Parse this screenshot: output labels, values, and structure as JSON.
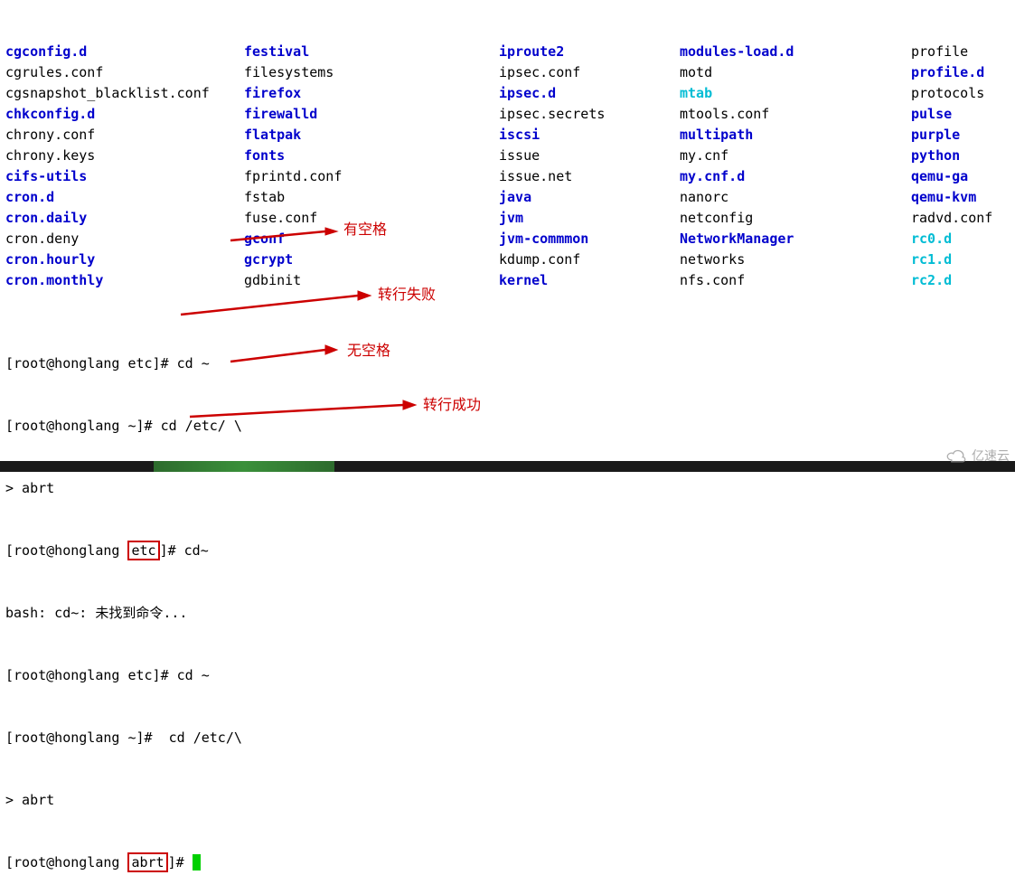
{
  "listing": {
    "col1": [
      {
        "name": "cgconfig.d",
        "cls": "dir"
      },
      {
        "name": "cgrules.conf",
        "cls": "plain"
      },
      {
        "name": "cgsnapshot_blacklist.conf",
        "cls": "plain"
      },
      {
        "name": "chkconfig.d",
        "cls": "dir"
      },
      {
        "name": "chrony.conf",
        "cls": "plain"
      },
      {
        "name": "chrony.keys",
        "cls": "plain"
      },
      {
        "name": "cifs-utils",
        "cls": "dir"
      },
      {
        "name": "cron.d",
        "cls": "dir"
      },
      {
        "name": "cron.daily",
        "cls": "dir"
      },
      {
        "name": "cron.deny",
        "cls": "plain"
      },
      {
        "name": "cron.hourly",
        "cls": "dir"
      },
      {
        "name": "cron.monthly",
        "cls": "dir"
      }
    ],
    "col2": [
      {
        "name": "festival",
        "cls": "dir"
      },
      {
        "name": "filesystems",
        "cls": "plain"
      },
      {
        "name": "firefox",
        "cls": "dir"
      },
      {
        "name": "firewalld",
        "cls": "dir"
      },
      {
        "name": "flatpak",
        "cls": "dir"
      },
      {
        "name": "fonts",
        "cls": "dir"
      },
      {
        "name": "fprintd.conf",
        "cls": "plain"
      },
      {
        "name": "fstab",
        "cls": "plain"
      },
      {
        "name": "fuse.conf",
        "cls": "plain"
      },
      {
        "name": "gconf",
        "cls": "dir"
      },
      {
        "name": "gcrypt",
        "cls": "dir"
      },
      {
        "name": "gdbinit",
        "cls": "plain"
      }
    ],
    "col3": [
      {
        "name": "iproute2",
        "cls": "dir"
      },
      {
        "name": "ipsec.conf",
        "cls": "plain"
      },
      {
        "name": "ipsec.d",
        "cls": "dir"
      },
      {
        "name": "ipsec.secrets",
        "cls": "plain"
      },
      {
        "name": "iscsi",
        "cls": "dir"
      },
      {
        "name": "issue",
        "cls": "plain"
      },
      {
        "name": "issue.net",
        "cls": "plain"
      },
      {
        "name": "java",
        "cls": "dir"
      },
      {
        "name": "jvm",
        "cls": "dir"
      },
      {
        "name": "jvm-commmon",
        "cls": "dir"
      },
      {
        "name": "kdump.conf",
        "cls": "plain"
      },
      {
        "name": "kernel",
        "cls": "dir"
      }
    ],
    "col4": [
      {
        "name": "modules-load.d",
        "cls": "dir"
      },
      {
        "name": "motd",
        "cls": "plain"
      },
      {
        "name": "mtab",
        "cls": "link"
      },
      {
        "name": "mtools.conf",
        "cls": "plain"
      },
      {
        "name": "multipath",
        "cls": "dir"
      },
      {
        "name": "my.cnf",
        "cls": "plain"
      },
      {
        "name": "my.cnf.d",
        "cls": "dir"
      },
      {
        "name": "nanorc",
        "cls": "plain"
      },
      {
        "name": "netconfig",
        "cls": "plain"
      },
      {
        "name": "NetworkManager",
        "cls": "dir"
      },
      {
        "name": "networks",
        "cls": "plain"
      },
      {
        "name": "nfs.conf",
        "cls": "plain"
      }
    ],
    "col5": [
      {
        "name": "profile",
        "cls": "plain"
      },
      {
        "name": "profile.d",
        "cls": "dir"
      },
      {
        "name": "protocols",
        "cls": "plain"
      },
      {
        "name": "pulse",
        "cls": "dir"
      },
      {
        "name": "purple",
        "cls": "dir"
      },
      {
        "name": "python",
        "cls": "dir"
      },
      {
        "name": "qemu-ga",
        "cls": "dir"
      },
      {
        "name": "qemu-kvm",
        "cls": "dir"
      },
      {
        "name": "radvd.conf",
        "cls": "plain"
      },
      {
        "name": "rc0.d",
        "cls": "link"
      },
      {
        "name": "rc1.d",
        "cls": "link"
      },
      {
        "name": "rc2.d",
        "cls": "link"
      }
    ]
  },
  "session": {
    "l1": "[root@honglang etc]# cd ~",
    "l2": "[root@honglang ~]# cd /etc/ \\",
    "l3": "> abrt",
    "l4a": "[root@honglang ",
    "l4b": "etc",
    "l4c": "]# cd~",
    "l5": "bash: cd~: 未找到命令...",
    "l6": "[root@honglang etc]# cd ~",
    "l7": "[root@honglang ~]#  cd /etc/\\",
    "l8": "> abrt",
    "l9a": "[root@honglang ",
    "l9b": "abrt",
    "l9c": "]# "
  },
  "annotations": {
    "a1": "有空格",
    "a2": "转行失败",
    "a3": "无空格",
    "a4": "转行成功"
  },
  "watermark": "亿速云"
}
